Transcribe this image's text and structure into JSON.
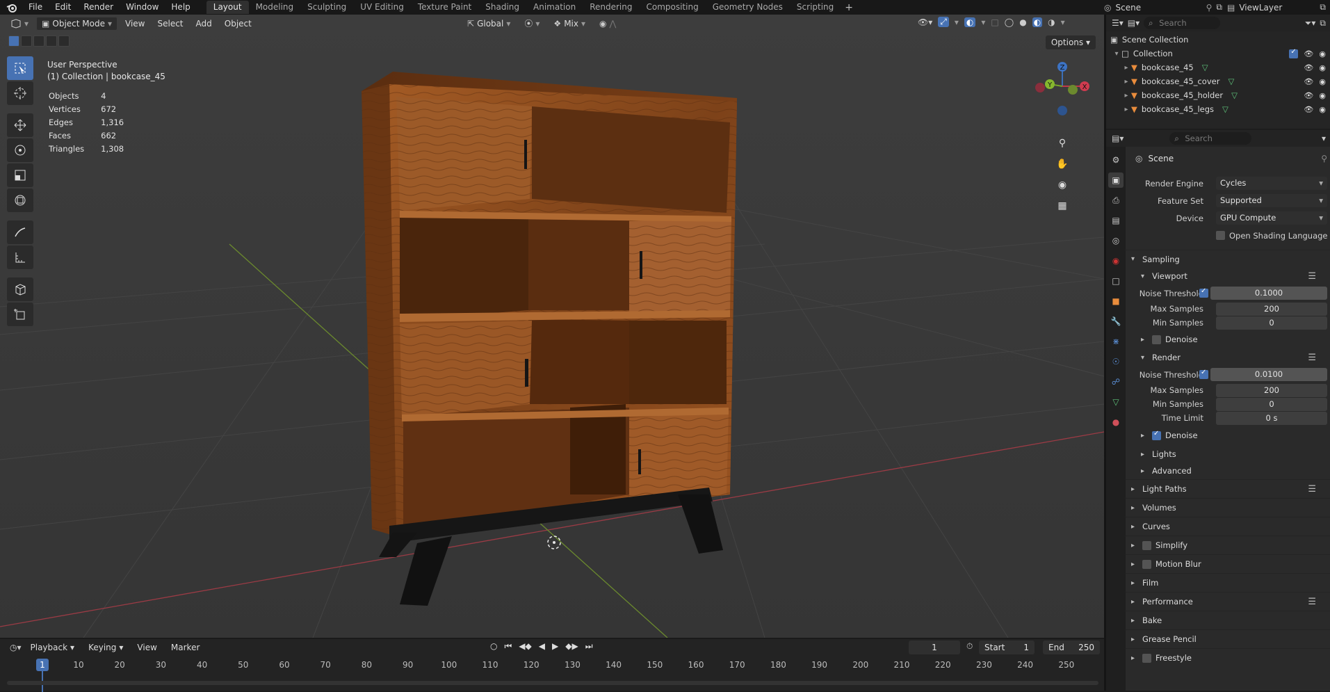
{
  "topbar": {
    "menus": [
      "File",
      "Edit",
      "Render",
      "Window",
      "Help"
    ],
    "workspaces": [
      "Layout",
      "Modeling",
      "Sculpting",
      "UV Editing",
      "Texture Paint",
      "Shading",
      "Animation",
      "Rendering",
      "Compositing",
      "Geometry Nodes",
      "Scripting"
    ],
    "active_workspace": "Layout",
    "add_tab": "+",
    "scene": "Scene",
    "view_layer": "ViewLayer"
  },
  "viewport": {
    "mode": "Object Mode",
    "menus": [
      "View",
      "Select",
      "Add",
      "Object"
    ],
    "orientation": "Global",
    "pivot": "Mix",
    "options": "Options",
    "perspective": "User Perspective",
    "collection_line": "(1) Collection | bookcase_45",
    "stats": [
      {
        "label": "Objects",
        "value": "4"
      },
      {
        "label": "Vertices",
        "value": "672"
      },
      {
        "label": "Edges",
        "value": "1,316"
      },
      {
        "label": "Faces",
        "value": "662"
      },
      {
        "label": "Triangles",
        "value": "1,308"
      }
    ],
    "gizmo": {
      "z": "Z",
      "y": "Y",
      "x": "X"
    }
  },
  "outliner": {
    "search_placeholder": "Search",
    "root": "Scene Collection",
    "collection": "Collection",
    "objects": [
      "bookcase_45",
      "bookcase_45_cover",
      "bookcase_45_holder",
      "bookcase_45_legs"
    ]
  },
  "properties": {
    "search_placeholder": "Search",
    "title": "Scene",
    "render_engine_label": "Render Engine",
    "render_engine": "Cycles",
    "feature_set_label": "Feature Set",
    "feature_set": "Supported",
    "device_label": "Device",
    "device": "GPU Compute",
    "osl": "Open Shading Language",
    "sampling": "Sampling",
    "viewport": "Viewport",
    "noise_threshold_label": "Noise Threshold",
    "vp_noise": "0.1000",
    "max_samples_label": "Max Samples",
    "vp_max": "200",
    "min_samples_label": "Min Samples",
    "vp_min": "0",
    "denoise": "Denoise",
    "render": "Render",
    "r_noise": "0.0100",
    "r_max": "200",
    "r_min": "0",
    "time_limit_label": "Time Limit",
    "r_time": "0 s",
    "lights": "Lights",
    "advanced": "Advanced",
    "panels": [
      "Light Paths",
      "Volumes",
      "Curves",
      "Simplify",
      "Motion Blur",
      "Film",
      "Performance",
      "Bake",
      "Grease Pencil",
      "Freestyle"
    ]
  },
  "timeline": {
    "menus": [
      "Playback",
      "Keying",
      "View",
      "Marker"
    ],
    "current_frame": "1",
    "start_label": "Start",
    "start": "1",
    "end_label": "End",
    "end": "250",
    "ticks": [
      "10",
      "20",
      "30",
      "40",
      "50",
      "60",
      "70",
      "80",
      "90",
      "100",
      "110",
      "120",
      "130",
      "140",
      "150",
      "160",
      "170",
      "180",
      "190",
      "200",
      "210",
      "220",
      "230",
      "240",
      "250"
    ]
  },
  "colors": {
    "accent": "#4772b3",
    "wood": "#8a4a1e",
    "legs": "#111111"
  }
}
